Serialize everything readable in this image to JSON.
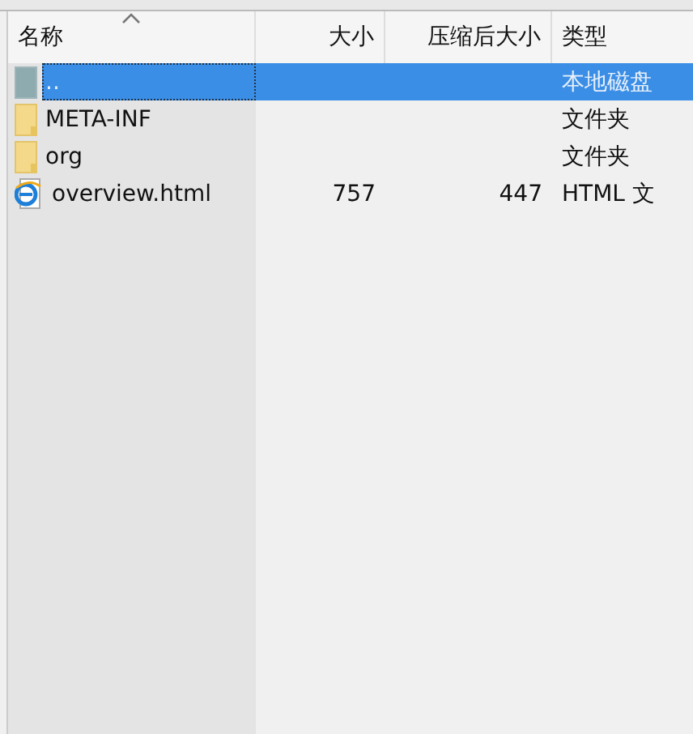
{
  "table": {
    "columns": [
      {
        "label": "名称",
        "sorted": true
      },
      {
        "label": "大小",
        "sorted": false
      },
      {
        "label": "压缩后大小",
        "sorted": false
      },
      {
        "label": "类型",
        "sorted": false
      }
    ],
    "rows": [
      {
        "kind": "parent",
        "name": "..",
        "size": "",
        "packed": "",
        "type": "本地磁盘",
        "selected": true
      },
      {
        "kind": "folder",
        "name": "META-INF",
        "size": "",
        "packed": "",
        "type": "文件夹",
        "selected": false
      },
      {
        "kind": "folder",
        "name": "org",
        "size": "",
        "packed": "",
        "type": "文件夹",
        "selected": false
      },
      {
        "kind": "html",
        "name": "overview.html",
        "size": "757",
        "packed": "447",
        "type": "HTML 文",
        "selected": false
      }
    ]
  }
}
